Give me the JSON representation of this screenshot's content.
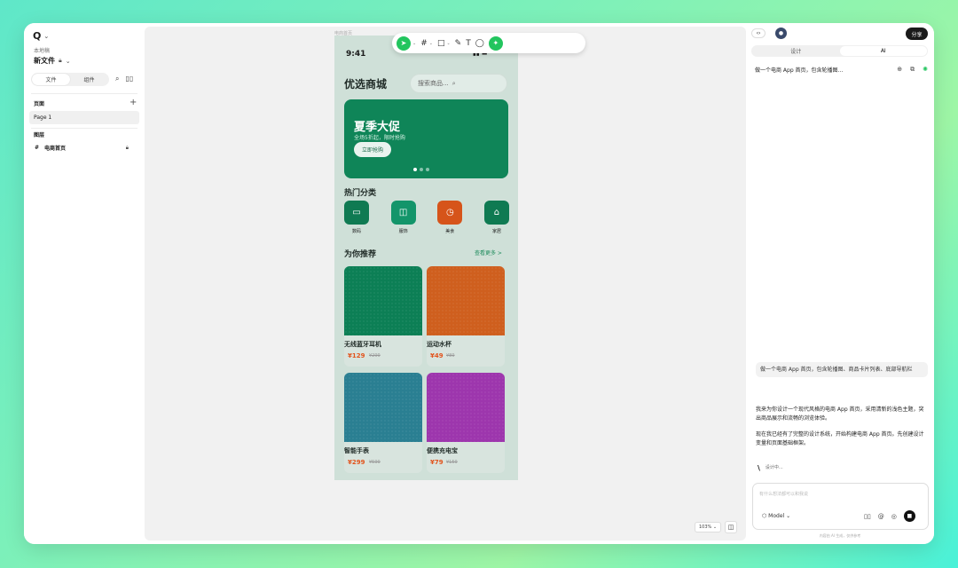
{
  "app": {
    "logo": "Q",
    "team": "本地稿",
    "file_name": "新文件",
    "left_tabs": [
      "文件",
      "组件"
    ],
    "pages_title": "页面",
    "pages": [
      "Page 1"
    ],
    "layers_title": "图层",
    "layers": [
      "电商首页"
    ]
  },
  "toolbar": {
    "tools": [
      "select-tool",
      "frame-tool",
      "rectangle-tool",
      "pen-tool",
      "text-tool",
      "comment-tool",
      "ai-tool"
    ],
    "text_tool": "T"
  },
  "canvas": {
    "frame_label": "电商首页",
    "zoom": "103%"
  },
  "phone": {
    "time": "9:41",
    "shop_title": "优选商城",
    "search_placeholder": "搜索商品...",
    "banner": {
      "title": "夏季大促",
      "subtitle": "全场5折起，限时抢购",
      "button": "立即抢购",
      "color": "#0f8558"
    },
    "categories_title": "热门分类",
    "categories": [
      {
        "label": "数码",
        "icon": "monitor-icon",
        "color": "#0f7a52"
      },
      {
        "label": "服饰",
        "icon": "bag-icon",
        "color": "#13956a"
      },
      {
        "label": "美食",
        "icon": "clock-icon",
        "color": "#d6541a"
      },
      {
        "label": "家居",
        "icon": "home-icon",
        "color": "#0f7a52"
      }
    ],
    "recommend_title": "为你推荐",
    "see_more": "查看更多 >",
    "products": [
      {
        "name": "无线蓝牙耳机",
        "price": "¥129",
        "old_price": "¥299",
        "color1": "#0c7f55",
        "color2": "#1ba070"
      },
      {
        "name": "运动水杯",
        "price": "¥49",
        "old_price": "¥89",
        "color1": "#c8501a",
        "color2": "#e07a2a"
      },
      {
        "name": "智能手表",
        "price": "¥299",
        "old_price": "¥599",
        "color1": "#2a6aa8",
        "color2": "#2fa07c"
      },
      {
        "name": "便携充电宝",
        "price": "¥79",
        "old_price": "¥159",
        "color1": "#7e2cc0",
        "color2": "#c0409a"
      }
    ]
  },
  "right_panel": {
    "code_btn": "‹›",
    "share": "分享",
    "tabs": [
      "设计",
      "AI"
    ],
    "thread_title": "做一个电商 App 首页，包含轮播图...",
    "user_message": "做一个电商 App 首页，包含轮播图、商品卡片列表、底部导航栏",
    "ai_messages": [
      "我来为你设计一个现代风格的电商 App 首页，采用清新的浅色主题，突出商品展示和流畅的浏览体验。",
      "现在我已经有了完整的设计系统，开始构建电商 App 首页。先创建设计变量和页面基础框架。"
    ],
    "status": "设计中...",
    "input_placeholder": "有什么想法都可以和我说",
    "model": "Model",
    "footnote": "内容由 AI 生成，仅供参考"
  }
}
